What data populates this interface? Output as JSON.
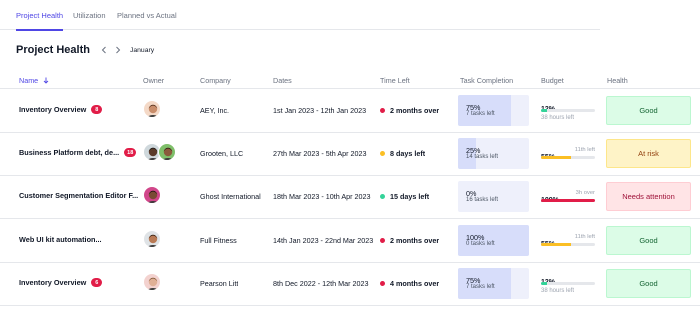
{
  "tabs": [
    {
      "label": "Project Health",
      "active": true
    },
    {
      "label": "Utilization",
      "active": false
    },
    {
      "label": "Planned vs Actual",
      "active": false
    }
  ],
  "page_title": "Project Health",
  "month": "January",
  "columns": {
    "name": "Name",
    "owner": "Owner",
    "company": "Company",
    "dates": "Dates",
    "time_left": "Time Left",
    "task_completion": "Task Completion",
    "budget": "Budget",
    "health": "Health"
  },
  "colors": {
    "accent": "#4f46e5",
    "red": "#e11d48",
    "yellow": "#fbbf24",
    "green": "#34d399"
  },
  "rows": [
    {
      "project": "Inventory Overview",
      "badge": "8",
      "owners": [
        "woman-avatar"
      ],
      "company": "AEY, Inc.",
      "dates": "1st Jan 2023 - 12th Jan 2023",
      "time_left": "2 months over",
      "time_status": "red",
      "task_pct": "75%",
      "task_pct_num": 75,
      "tasks_left": "7 tasks left",
      "budget_pct": "12%",
      "budget_num": 12,
      "budget_extra": "",
      "budget_color": "green",
      "budget_hours": "38 hours left",
      "health": "Good",
      "health_type": "good"
    },
    {
      "project": "Business Platform debt, de...",
      "badge": "18",
      "owners": [
        "man-avatar",
        "man-avatar-2"
      ],
      "company": "Grooten, LLC",
      "dates": "27th Mar 2023 - 5th Apr 2023",
      "time_left": "8 days left",
      "time_status": "yellow",
      "task_pct": "25%",
      "task_pct_num": 25,
      "tasks_left": "14 tasks left",
      "budget_pct": "55%",
      "budget_num": 55,
      "budget_extra": "11th left",
      "budget_color": "yellow",
      "budget_hours": "",
      "health": "At risk",
      "health_type": "risk"
    },
    {
      "project": "Customer Segmentation Editor F...",
      "badge": "",
      "owners": [
        "woman-avatar-2"
      ],
      "company": "Ghost International",
      "dates": "18th Mar 2023 - 10th Apr 2023",
      "time_left": "15 days left",
      "time_status": "green",
      "task_pct": "0%",
      "task_pct_num": 0,
      "tasks_left": "16 tasks left",
      "budget_pct": "109%",
      "budget_num": 100,
      "budget_extra": "3h over",
      "budget_color": "red",
      "budget_hours": "",
      "health": "Needs attention",
      "health_type": "attn"
    },
    {
      "project": "Web UI kit automation...",
      "badge": "",
      "owners": [
        "man-avatar-3"
      ],
      "company": "Full Fitness",
      "dates": "14th Jan 2023 - 22nd Mar 2023",
      "time_left": "2 months over",
      "time_status": "red",
      "task_pct": "100%",
      "task_pct_num": 100,
      "tasks_left": "0 tasks left",
      "budget_pct": "55%",
      "budget_num": 55,
      "budget_extra": "11th left",
      "budget_color": "yellow",
      "budget_hours": "",
      "health": "Good",
      "health_type": "good"
    },
    {
      "project": "Inventory Overview",
      "badge": "6",
      "owners": [
        "woman-avatar-3"
      ],
      "company": "Pearson Litt",
      "dates": "8th Dec 2022 - 12th Mar 2023",
      "time_left": "4 months over",
      "time_status": "red",
      "task_pct": "75%",
      "task_pct_num": 75,
      "tasks_left": "7 tasks left",
      "budget_pct": "12%",
      "budget_num": 12,
      "budget_extra": "",
      "budget_color": "green",
      "budget_hours": "38 hours left",
      "health": "Good",
      "health_type": "good"
    }
  ]
}
